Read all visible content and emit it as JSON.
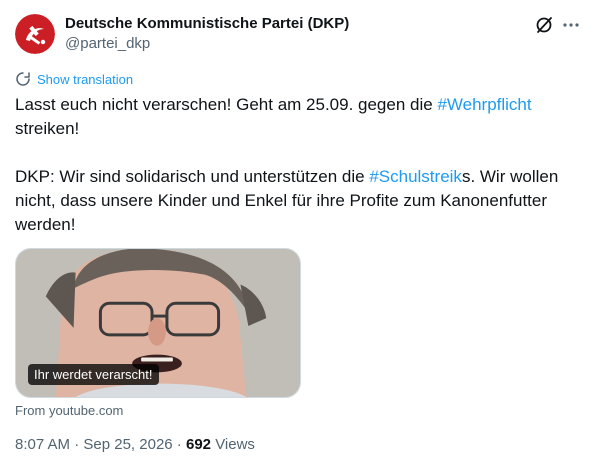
{
  "post": {
    "author_name": "Deutsche Kommunistische Partei (DKP)",
    "author_handle": "@partei_dkp",
    "translate_label": "Show translation",
    "text": {
      "p1_a": "Lasst euch nicht verarschen! Geht am 25.09. gegen die ",
      "p1_hashtag": "#Wehrpflicht",
      "p1_b": " streiken!",
      "p2_a": "DKP: Wir sind solidarisch und unterstützen die ",
      "p2_hashtag": "#Schulstreik",
      "p2_b": "s. Wir wollen nicht, dass unsere Kinder und Enkel für ihre Profite zum Kanonenfutter werden!"
    },
    "card": {
      "caption": "Ihr werdet verarscht!",
      "source": "From youtube.com"
    },
    "time": "8:07 AM",
    "separator": " · ",
    "date": "Sep 25, 2026",
    "views_count": "692",
    "views_label": "Views"
  },
  "icons": {
    "avatar": "party-logo-icon",
    "grok": "grok-icon",
    "more": "more-dots-icon",
    "translate": "translate-icon"
  },
  "colors": {
    "avatar_red": "#cc1f25",
    "link_blue": "#1d9bf0",
    "secondary_text": "#536471",
    "primary_text": "#0f1419"
  }
}
